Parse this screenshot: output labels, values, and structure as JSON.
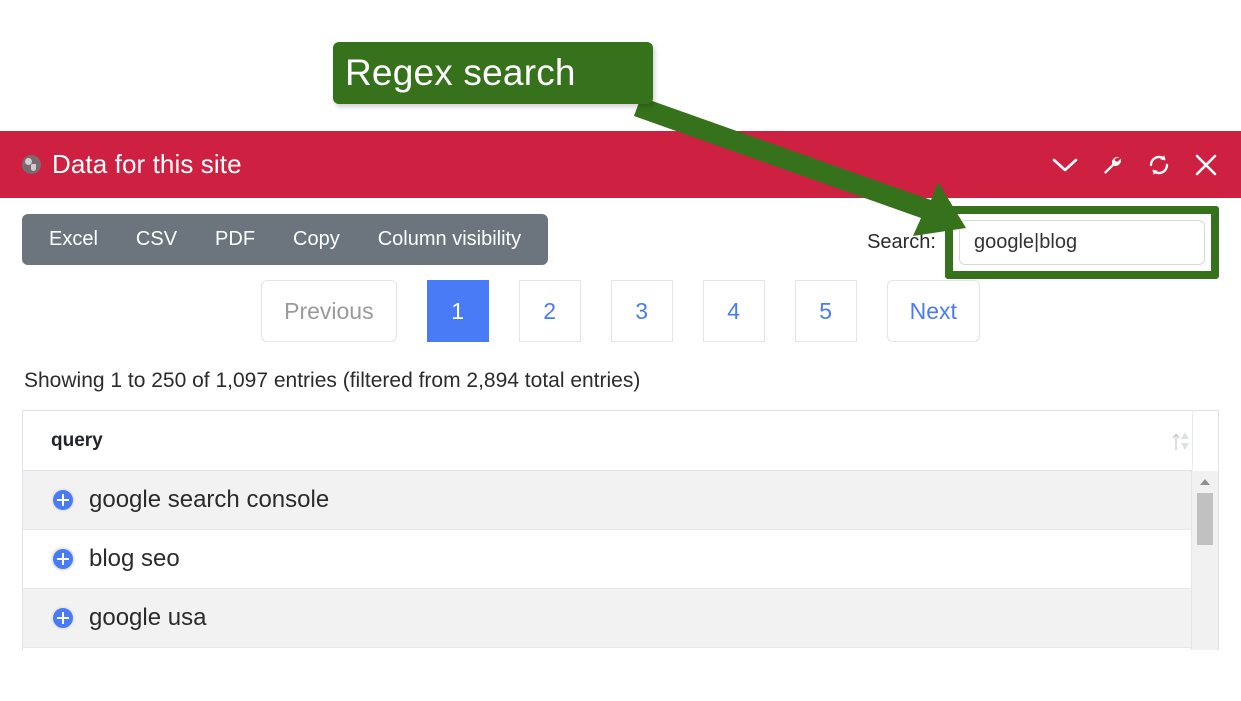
{
  "annotation": {
    "label": "Regex search",
    "color": "#36711c",
    "arrow_icon": "arrow-icon"
  },
  "panel": {
    "title": "Data for this site",
    "header_color": "#ce2142",
    "site_icon": "globe-icon",
    "actions": [
      {
        "name": "collapse-button",
        "icon": "chevron-down-icon"
      },
      {
        "name": "settings-button",
        "icon": "wrench-icon"
      },
      {
        "name": "refresh-button",
        "icon": "refresh-icon"
      },
      {
        "name": "close-button",
        "icon": "close-icon"
      }
    ]
  },
  "toolbar": {
    "background": "#6c757d",
    "buttons": [
      {
        "label": "Excel"
      },
      {
        "label": "CSV"
      },
      {
        "label": "PDF"
      },
      {
        "label": "Copy"
      },
      {
        "label": "Column visibility"
      }
    ]
  },
  "search": {
    "label": "Search:",
    "value": "google|blog",
    "placeholder": ""
  },
  "pagination": {
    "previous_label": "Previous",
    "next_label": "Next",
    "pages": [
      "1",
      "2",
      "3",
      "4",
      "5"
    ],
    "active_page": "1",
    "previous_disabled": true,
    "active_color": "#4a7bf7"
  },
  "info": {
    "text": "Showing 1 to 250 of 1,097 entries (filtered from 2,894 total entries)",
    "start": 1,
    "end": 250,
    "filtered_total": "1,097",
    "grand_total": "2,894"
  },
  "table": {
    "columns": [
      {
        "label": "query",
        "sort_icon": "sort-updown-icon"
      }
    ],
    "rows": [
      {
        "expand_icon": "plus-circle-icon",
        "query": "google search console"
      },
      {
        "expand_icon": "plus-circle-icon",
        "query": "blog seo"
      },
      {
        "expand_icon": "plus-circle-icon",
        "query": "google usa"
      }
    ],
    "scrollbar": {
      "up_arrow_icon": "triangle-up-icon"
    }
  }
}
